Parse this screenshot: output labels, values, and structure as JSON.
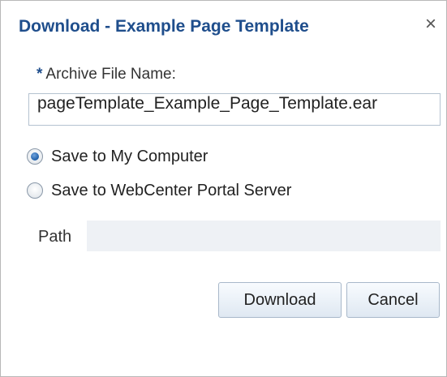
{
  "dialog": {
    "title": "Download - Example Page Template",
    "close_glyph": "×"
  },
  "archive": {
    "required_marker": "*",
    "label": "Archive File Name:",
    "value": "pageTemplate_Example_Page_Template.ear"
  },
  "destination": {
    "options": [
      {
        "label": "Save to My Computer",
        "selected": true
      },
      {
        "label": "Save to WebCenter Portal Server",
        "selected": false
      }
    ]
  },
  "path": {
    "label": "Path",
    "value": ""
  },
  "buttons": {
    "download_label": "Download",
    "cancel_label": "Cancel"
  },
  "colors": {
    "title": "#1f4e8c",
    "radio_selected": "#1f5fa8",
    "button_border": "#a8b8ca"
  }
}
